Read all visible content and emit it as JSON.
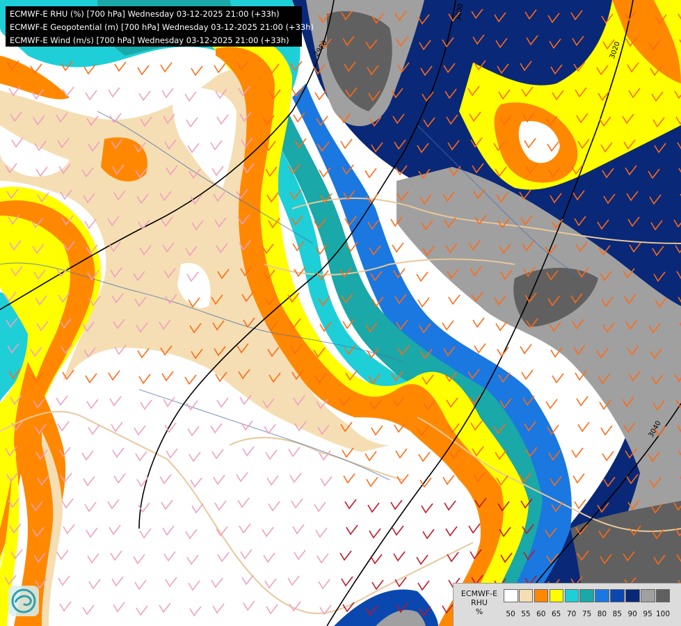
{
  "header": {
    "lines": [
      "ECMWF-E RHU (%) [700 hPa] Wednesday 03-12-2025 21:00 (+33h)",
      "ECMWF-E Geopotential (m) [700 hPa] Wednesday 03-12-2025 21:00 (+33h)",
      "ECMWF-E Wind (m/s) [700 hPa] Wednesday 03-12-2025 21:00 (+33h)"
    ]
  },
  "legend": {
    "title_line1": "ECMWF-E",
    "title_line2": "RHU",
    "title_line3": "%",
    "ticks": [
      "50",
      "55",
      "60",
      "65",
      "70",
      "75",
      "80",
      "85",
      "90",
      "95",
      "100"
    ],
    "colors": [
      "#ffffff",
      "#f5deb3",
      "#ff8800",
      "#ffff00",
      "#1ecfd8",
      "#1aa8a8",
      "#1a78e0",
      "#0a48b0",
      "#0a2878",
      "#a0a0a0",
      "#606060"
    ]
  },
  "contours": {
    "labels": [
      "2980",
      "3000",
      "3020",
      "3040"
    ]
  },
  "colors": {
    "title_bg": "#000000",
    "contour_line": "#000000",
    "border_tan": "#e8c89a",
    "river": "#4a6fb0",
    "barb_pink": "#f0a0c0",
    "barb_orange": "#ff6a14",
    "barb_red": "#c01428"
  },
  "icons": [
    "agency-logo-icon"
  ]
}
